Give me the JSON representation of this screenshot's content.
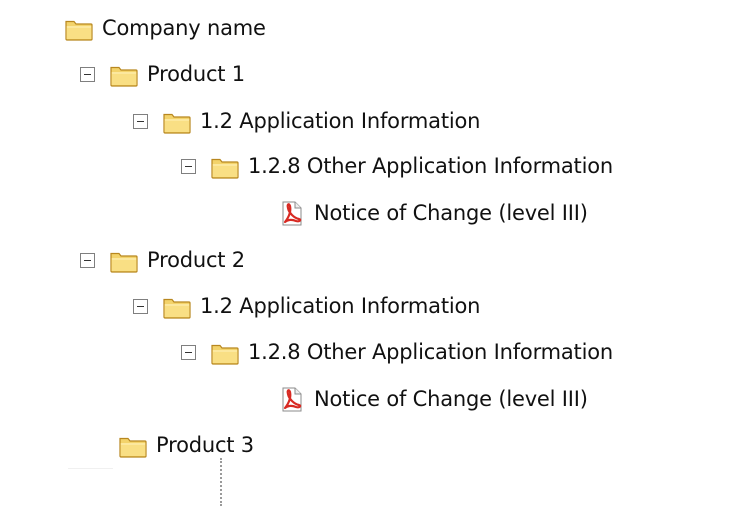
{
  "tree": {
    "root": {
      "label": "Company name",
      "icon": "folder-icon"
    },
    "product1": {
      "label": "Product 1",
      "icon": "folder-icon",
      "toggle": "collapse",
      "app_info": {
        "label": "1.2 Application Information",
        "icon": "folder-icon",
        "toggle": "collapse",
        "other_info": {
          "label": "1.2.8 Other Application Information",
          "icon": "folder-icon",
          "toggle": "collapse",
          "document": {
            "label": "Notice of Change (level III)",
            "icon": "pdf-icon"
          }
        }
      }
    },
    "product2": {
      "label": "Product 2",
      "icon": "folder-icon",
      "toggle": "collapse",
      "app_info": {
        "label": "1.2 Application Information",
        "icon": "folder-icon",
        "toggle": "collapse",
        "other_info": {
          "label": "1.2.8 Other Application Information",
          "icon": "folder-icon",
          "toggle": "collapse",
          "document": {
            "label": "Notice of Change (level III)",
            "icon": "pdf-icon"
          }
        }
      }
    },
    "product3": {
      "label": "Product 3",
      "icon": "folder-icon"
    }
  },
  "colors": {
    "folder_fill": "#f3d36b",
    "folder_outline": "#b8871f",
    "pdf_red": "#d82a23",
    "toggle_border": "#7f7f7f",
    "text": "#111111"
  }
}
